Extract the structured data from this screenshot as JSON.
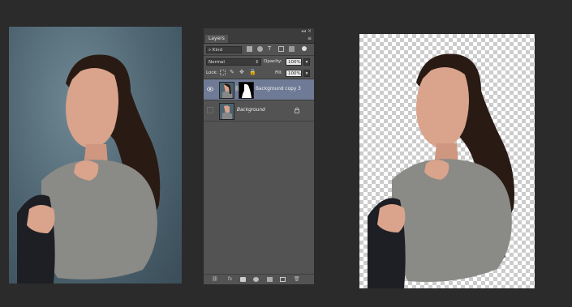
{
  "layers_panel": {
    "tab_label": "Layers",
    "filter_label": "Kind",
    "blend_mode": "Normal",
    "opacity_label": "Opacity:",
    "opacity_value": "100%",
    "lock_label": "Lock:",
    "fill_label": "Fill:",
    "fill_value": "100%",
    "layers": [
      {
        "name": "Background copy 3",
        "visible": true,
        "selected": true,
        "has_mask": true
      },
      {
        "name": "Background",
        "visible": false,
        "selected": false,
        "locked": true
      }
    ],
    "bottom_icons": [
      "link-icon",
      "fx-icon",
      "mask-icon",
      "adjustment-icon",
      "group-icon",
      "new-layer-icon",
      "trash-icon"
    ]
  },
  "colors": {
    "app_background": "#2b2b2b",
    "panel": "#535353",
    "selection": "#6f7b96"
  }
}
